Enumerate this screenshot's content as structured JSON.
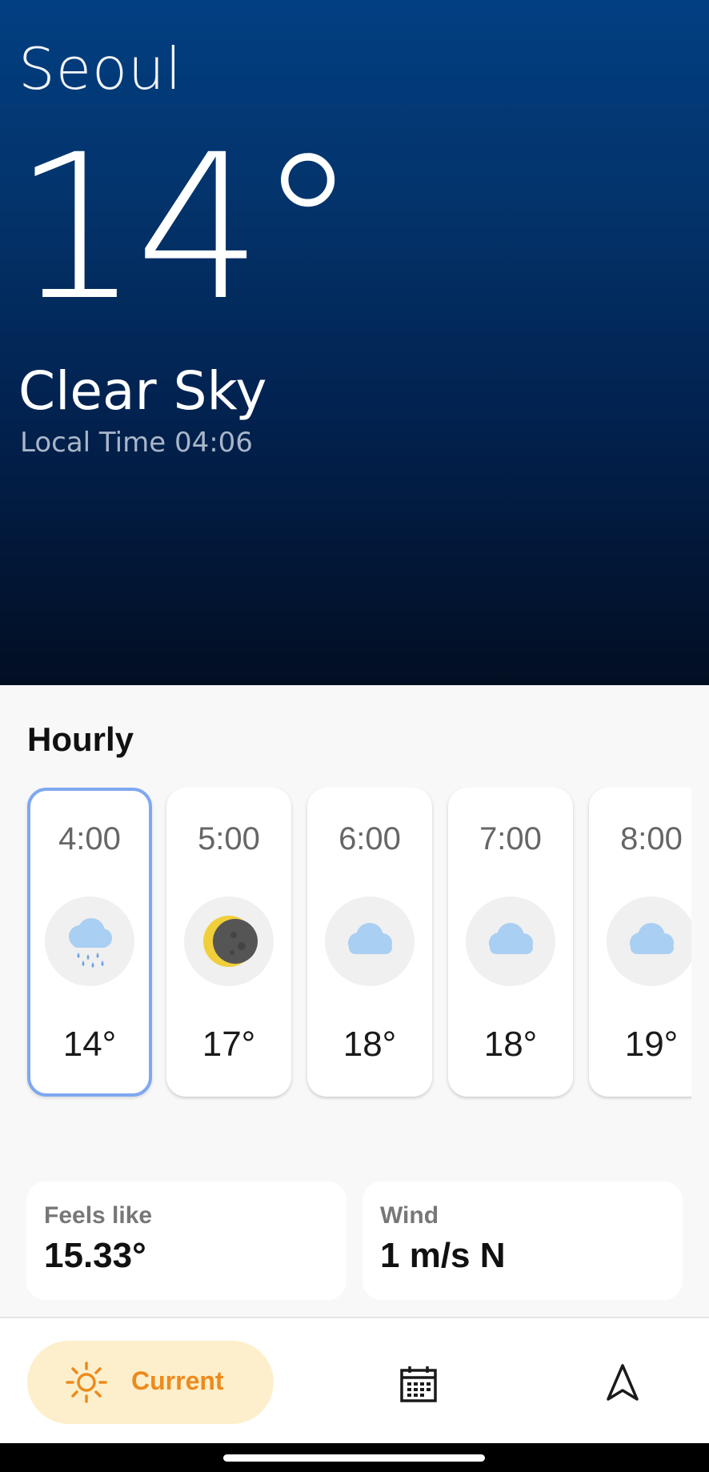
{
  "current": {
    "city": "Seoul",
    "temperature": "14°",
    "condition": "Clear Sky",
    "local_time": "Local Time 04:06"
  },
  "hourly": {
    "title": "Hourly",
    "items": [
      {
        "time": "4:00",
        "icon": "rain-cloud-icon",
        "temp": "14°",
        "selected": true
      },
      {
        "time": "5:00",
        "icon": "moon-icon",
        "temp": "17°",
        "selected": false
      },
      {
        "time": "6:00",
        "icon": "cloud-icon",
        "temp": "18°",
        "selected": false
      },
      {
        "time": "7:00",
        "icon": "cloud-icon",
        "temp": "18°",
        "selected": false
      },
      {
        "time": "8:00",
        "icon": "cloud-icon",
        "temp": "19°",
        "selected": false
      }
    ]
  },
  "details": {
    "feels_like_label": "Feels like",
    "feels_like_value": "15.33°",
    "wind_label": "Wind",
    "wind_value": "1 m/s N"
  },
  "nav": {
    "current_label": "Current",
    "items": [
      "sun-icon",
      "calendar-icon",
      "navigation-arrow-icon"
    ]
  },
  "colors": {
    "accent": "#ed8a1c",
    "accent_bg": "#fdefcb",
    "selected_border": "#7fa8f0",
    "hero_top": "#023f82",
    "hero_bottom": "#020e22"
  }
}
